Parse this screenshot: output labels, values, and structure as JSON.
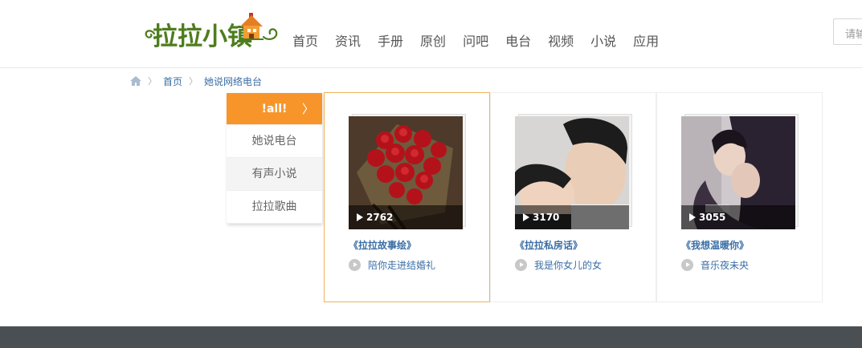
{
  "logo": {
    "text": "拉拉小镇"
  },
  "nav": {
    "items": [
      "首页",
      "资讯",
      "手册",
      "原创",
      "问吧",
      "电台",
      "视频",
      "小说",
      "应用"
    ]
  },
  "search": {
    "placeholder": "请输"
  },
  "breadcrumb": {
    "home": "首页",
    "current": "她说网络电台"
  },
  "side_menu": {
    "items": [
      {
        "label": "!all!",
        "active": true
      },
      {
        "label": "她说电台"
      },
      {
        "label": "有声小说"
      },
      {
        "label": "拉拉歌曲"
      }
    ]
  },
  "cards": [
    {
      "plays": "2762",
      "title": "《拉拉故事绘》",
      "subtitle": "陪你走进结婚礼",
      "image": "red-roses-bouquet"
    },
    {
      "plays": "3170",
      "title": "《拉拉私房话》",
      "subtitle": "我是你女儿的女",
      "image": "couple-kiss"
    },
    {
      "plays": "3055",
      "title": "《我想温暖你》",
      "subtitle": "音乐夜未央",
      "image": "couple-embrace"
    }
  ],
  "colors": {
    "accent": "#f7952b",
    "link": "#3a6ea5",
    "logo_green": "#4e7d1e",
    "footer": "#4a4f53"
  }
}
